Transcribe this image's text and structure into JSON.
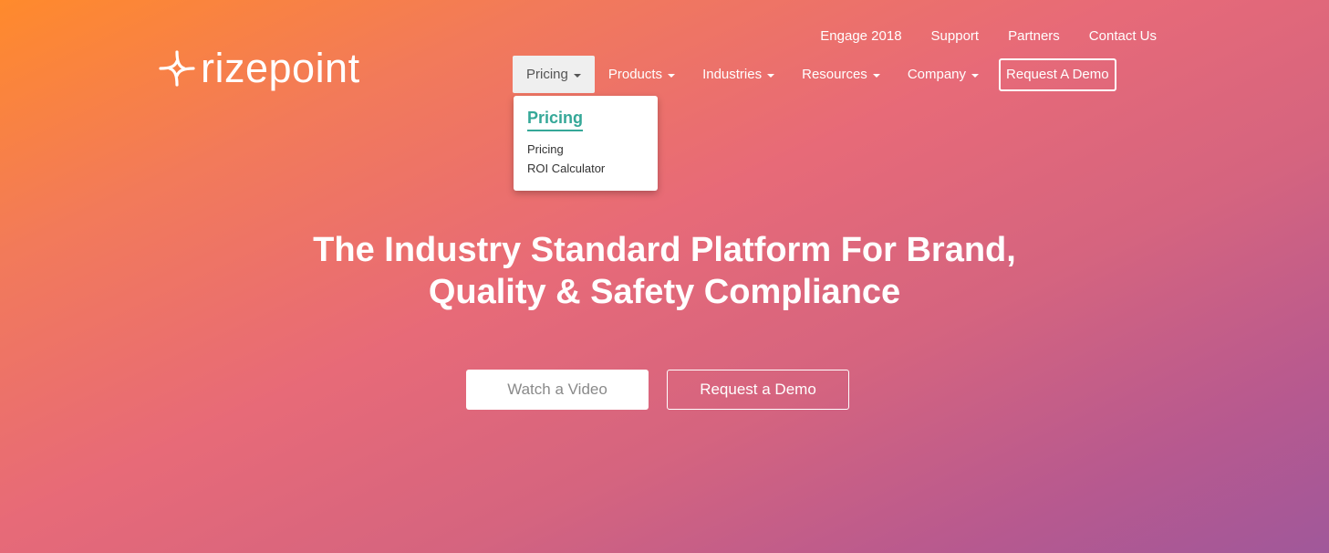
{
  "brand": {
    "name": "rizepoint",
    "logo_icon": "sparkle-star-icon"
  },
  "utility_nav": [
    "Engage 2018",
    "Support",
    "Partners",
    "Contact Us"
  ],
  "main_nav": {
    "items": [
      "Pricing",
      "Products",
      "Industries",
      "Resources",
      "Company"
    ],
    "active": "Pricing",
    "request_demo": "Request A Demo"
  },
  "dropdown": {
    "title": "Pricing",
    "items": [
      "Pricing",
      "ROI Calculator"
    ],
    "accent_color": "#35a898"
  },
  "hero": {
    "title_line1": "The Industry Standard Platform For Brand,",
    "title_line2": "Quality & Safety Compliance",
    "watch_video": "Watch a Video",
    "request_demo": "Request a Demo"
  },
  "colors": {
    "gradient_start": "#ff8a2c",
    "gradient_mid": "#e76a78",
    "gradient_end": "#a0589a"
  }
}
